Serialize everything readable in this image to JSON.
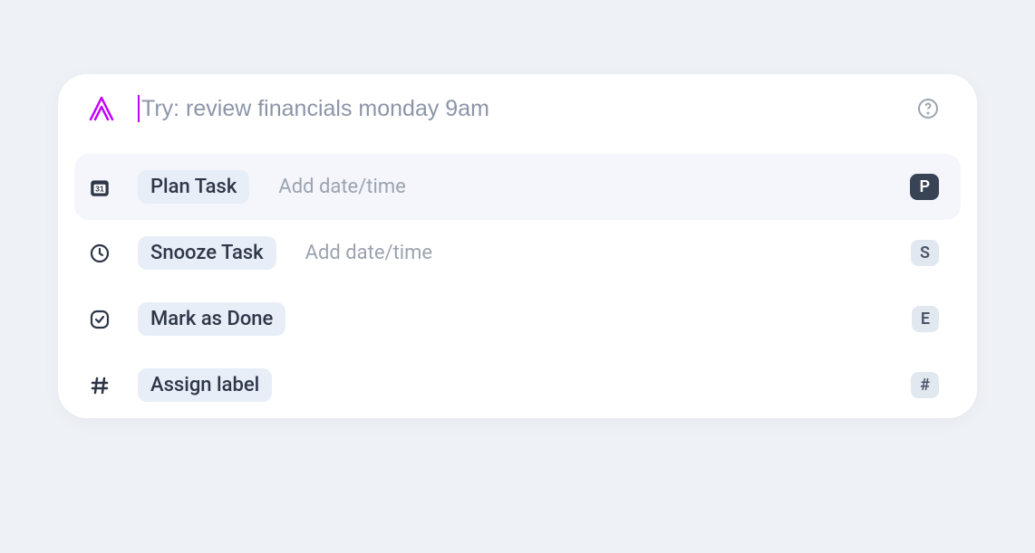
{
  "search": {
    "placeholder": "Try: review financials monday 9am",
    "value": ""
  },
  "menu": {
    "items": [
      {
        "label": "Plan Task",
        "hint": "Add date/time",
        "shortcut": "P",
        "shortcut_style": "dark",
        "icon": "calendar",
        "selected": true
      },
      {
        "label": "Snooze Task",
        "hint": "Add date/time",
        "shortcut": "S",
        "shortcut_style": "light",
        "icon": "clock",
        "selected": false
      },
      {
        "label": "Mark as Done",
        "hint": "",
        "shortcut": "E",
        "shortcut_style": "light",
        "icon": "check",
        "selected": false
      },
      {
        "label": "Assign label",
        "hint": "",
        "shortcut": "#",
        "shortcut_style": "light",
        "icon": "hash",
        "selected": false
      }
    ]
  }
}
